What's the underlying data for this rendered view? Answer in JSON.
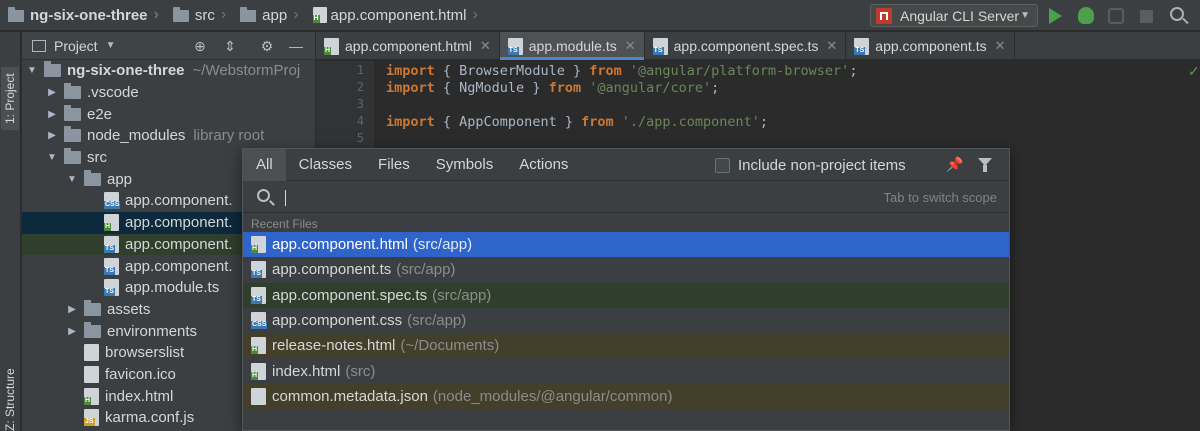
{
  "breadcrumbs": [
    "ng-six-one-three",
    "src",
    "app",
    "app.component.html"
  ],
  "run_config": {
    "label": "Angular CLI Server"
  },
  "side_strip": {
    "project_label": "1: Project",
    "structure_label": "Z: Structure"
  },
  "project_panel": {
    "title": "Project",
    "tree": [
      {
        "label": "ng-six-one-three",
        "meta": "~/WebstormProj",
        "kind": "folder",
        "expanded": true
      },
      {
        "label": ".vscode",
        "kind": "folder"
      },
      {
        "label": "e2e",
        "kind": "folder"
      },
      {
        "label": "node_modules",
        "meta": "library root",
        "kind": "folder"
      },
      {
        "label": "src",
        "kind": "folder",
        "expanded": true
      },
      {
        "label": "app",
        "kind": "folder",
        "expanded": true
      },
      {
        "label": "app.component.",
        "kind": "file",
        "type": "CSS"
      },
      {
        "label": "app.component.",
        "kind": "file",
        "type": "H"
      },
      {
        "label": "app.component.",
        "kind": "file",
        "type": "TS"
      },
      {
        "label": "app.component.",
        "kind": "file",
        "type": "TS"
      },
      {
        "label": "app.module.ts",
        "kind": "file",
        "type": "TS"
      },
      {
        "label": "assets",
        "kind": "folder"
      },
      {
        "label": "environments",
        "kind": "folder"
      },
      {
        "label": "browserslist",
        "kind": "file",
        "type": ""
      },
      {
        "label": "favicon.ico",
        "kind": "file",
        "type": ""
      },
      {
        "label": "index.html",
        "kind": "file",
        "type": "H"
      },
      {
        "label": "karma.conf.js",
        "kind": "file",
        "type": "JS"
      }
    ]
  },
  "tabs": [
    {
      "label": "app.component.html",
      "type": "H"
    },
    {
      "label": "app.module.ts",
      "type": "TS",
      "active": true
    },
    {
      "label": "app.component.spec.ts",
      "type": "TS"
    },
    {
      "label": "app.component.ts",
      "type": "TS"
    }
  ],
  "editor": {
    "lines": [
      {
        "n": "1",
        "kw": "import",
        "mid": " { BrowserModule } ",
        "kw2": "from",
        "str": " '@angular/platform-browser'",
        "end": ";"
      },
      {
        "n": "2",
        "kw": "import",
        "mid": " { NgModule } ",
        "kw2": "from",
        "str": " '@angular/core'",
        "end": ";"
      },
      {
        "n": "3",
        "kw": "",
        "mid": "",
        "kw2": "",
        "str": "",
        "end": ""
      },
      {
        "n": "4",
        "kw": "import",
        "mid": " { AppComponent } ",
        "kw2": "from",
        "str": " './app.component'",
        "end": ";"
      },
      {
        "n": "5",
        "kw": "",
        "mid": "",
        "kw2": "",
        "str": "",
        "end": ""
      }
    ]
  },
  "search_popup": {
    "tabs": [
      "All",
      "Classes",
      "Files",
      "Symbols",
      "Actions"
    ],
    "include_non_project": "Include non-project items",
    "scope_hint": "Tab to switch scope",
    "section": "Recent Files",
    "results": [
      {
        "name": "app.component.html",
        "path": "(src/app)",
        "type": "H",
        "state": "selected"
      },
      {
        "name": "app.component.ts",
        "path": "(src/app)",
        "type": "TS",
        "state": ""
      },
      {
        "name": "app.component.spec.ts",
        "path": "(src/app)",
        "type": "TS",
        "state": "spec"
      },
      {
        "name": "app.component.css",
        "path": "(src/app)",
        "type": "CSS",
        "state": ""
      },
      {
        "name": "release-notes.html",
        "path": "(~/Documents)",
        "type": "H",
        "state": "ext"
      },
      {
        "name": "index.html",
        "path": "(src)",
        "type": "H",
        "state": ""
      },
      {
        "name": "common.metadata.json",
        "path": "(node_modules/@angular/common)",
        "type": "",
        "state": "ext"
      }
    ]
  },
  "colors": {
    "selection": "#2f65ca",
    "spec_row": "#303e2c",
    "external_row": "#433f2b",
    "accent_green": "#4ca04c"
  }
}
